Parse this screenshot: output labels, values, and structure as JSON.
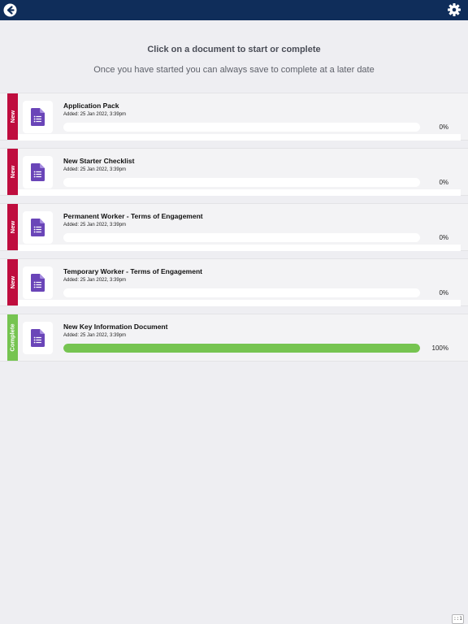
{
  "header": {
    "back_icon": "back-arrow-icon",
    "settings_icon": "gear-icon"
  },
  "heading": "Click on a document to start or complete",
  "subheading": "Once you have started you can always save to complete at a later date",
  "documents": [
    {
      "status": "New",
      "title": "Application Pack",
      "added": "Added: 25 Jan 2022, 3:39pm",
      "progress": 0,
      "progress_label": "0%"
    },
    {
      "status": "New",
      "title": "New Starter Checklist",
      "added": "Added: 25 Jan 2022, 3:39pm",
      "progress": 0,
      "progress_label": "0%"
    },
    {
      "status": "New",
      "title": "Permanent Worker - Terms of Engagement",
      "added": "Added: 25 Jan 2022, 3:39pm",
      "progress": 0,
      "progress_label": "0%"
    },
    {
      "status": "New",
      "title": "Temporary Worker - Terms of Engagement",
      "added": "Added: 25 Jan 2022, 3:39pm",
      "progress": 0,
      "progress_label": "0%"
    },
    {
      "status": "Complete",
      "title": "New Key Information Document",
      "added": "Added: 25 Jan 2022, 3:39pm",
      "progress": 1,
      "progress_label": "100%"
    }
  ],
  "corner_badge": "::1",
  "colors": {
    "header": "#0f2d5a",
    "status_new": "#bf0d3e",
    "status_complete": "#76c451",
    "doc_icon": "#6a45b8",
    "progress": "#76c451"
  }
}
